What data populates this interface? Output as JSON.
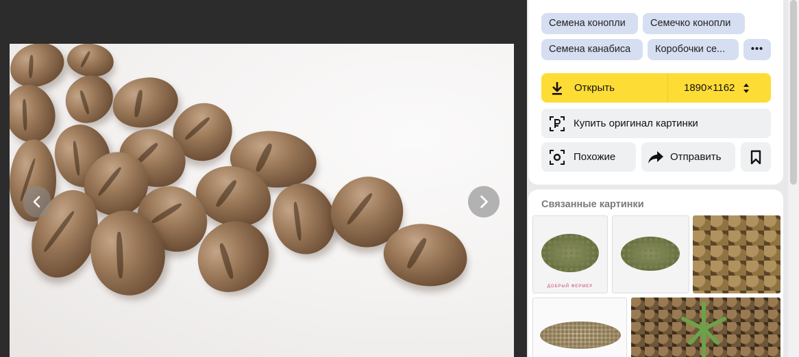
{
  "tags": [
    "Семена конопли",
    "Семечко конопли",
    "Семена канабиса",
    "Коробочки се..."
  ],
  "more_tags_label": "•••",
  "open": {
    "label": "Открыть",
    "size": "1890×1162"
  },
  "buy_label": "Купить оригинал картинки",
  "similar_label": "Похожие",
  "share_label": "Отправить",
  "related": {
    "title": "Связанные картинки",
    "watermark": "ДОБРЫЙ ФЕРМЕР"
  },
  "colors": {
    "accent_yellow": "#fddc36",
    "chip_blue": "#d5dff1",
    "viewer_bg": "#2c2c2c"
  },
  "icons": [
    "chevron-left-icon",
    "chevron-right-icon",
    "download-icon",
    "sort-icon",
    "ruble-scan-icon",
    "similar-icon",
    "share-icon",
    "bookmark-icon"
  ]
}
